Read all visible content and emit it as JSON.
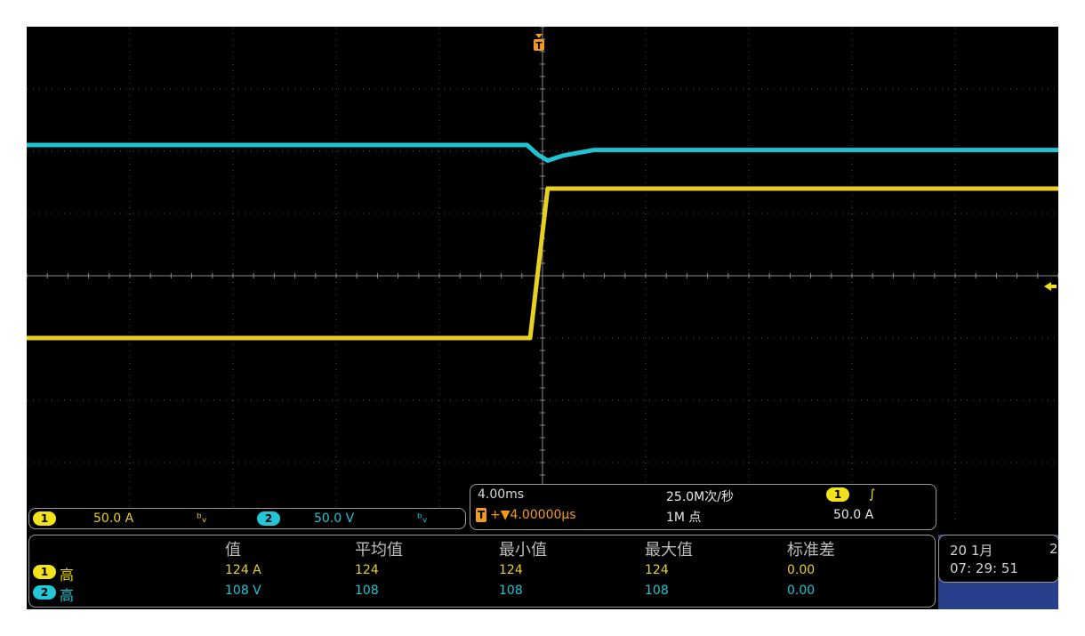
{
  "trigger_marker": {
    "label": "T",
    "color": "#f29a1c"
  },
  "channel_bar": {
    "ch1": {
      "badge": "1",
      "scale": "50.0 A",
      "coupling_icon": "bandwidth-icon"
    },
    "ch2": {
      "badge": "2",
      "scale": "50.0 V",
      "coupling_icon": "bandwidth-icon"
    }
  },
  "horizontal": {
    "time_per_div": "4.00ms",
    "sample_rate": "25.0M次/秒",
    "trigger_position": "+▼4.00000µs",
    "record_length": "1M 点",
    "trigger_source_badge": "1",
    "trigger_slope": "∫",
    "trigger_level": "50.0 A"
  },
  "measurements": {
    "headers": [
      "值",
      "平均值",
      "最小值",
      "最大值",
      "标准差"
    ],
    "rows": [
      {
        "badge": "1",
        "type": "高",
        "value": "124 A",
        "mean": "124",
        "min": "124",
        "max": "124",
        "std": "0.00"
      },
      {
        "badge": "2",
        "type": "高",
        "value": "108 V",
        "mean": "108",
        "min": "108",
        "max": "108",
        "std": "0.00"
      }
    ]
  },
  "clock": {
    "date": "20 1月",
    "year_partial": "2",
    "time": "07: 29: 51"
  },
  "colors": {
    "ch1": "#e8d020",
    "ch2": "#1fc3d2",
    "trigger": "#f29a1c",
    "grid": "#5a5a5a"
  },
  "chart_data": {
    "type": "line",
    "grid": true,
    "divisions": {
      "x": 10,
      "y": 8
    },
    "series": [
      {
        "name": "1",
        "color": "#e8d020",
        "x_div": [
          0,
          4.88,
          5.05,
          10
        ],
        "y_div": [
          -1.0,
          -1.0,
          1.4,
          1.4
        ]
      },
      {
        "name": "2",
        "color": "#1fc3d2",
        "x_div": [
          0,
          4.85,
          4.95,
          5.05,
          5.2,
          5.5,
          10
        ],
        "y_div": [
          2.1,
          2.1,
          1.95,
          1.85,
          1.93,
          2.02,
          2.02
        ]
      }
    ]
  }
}
